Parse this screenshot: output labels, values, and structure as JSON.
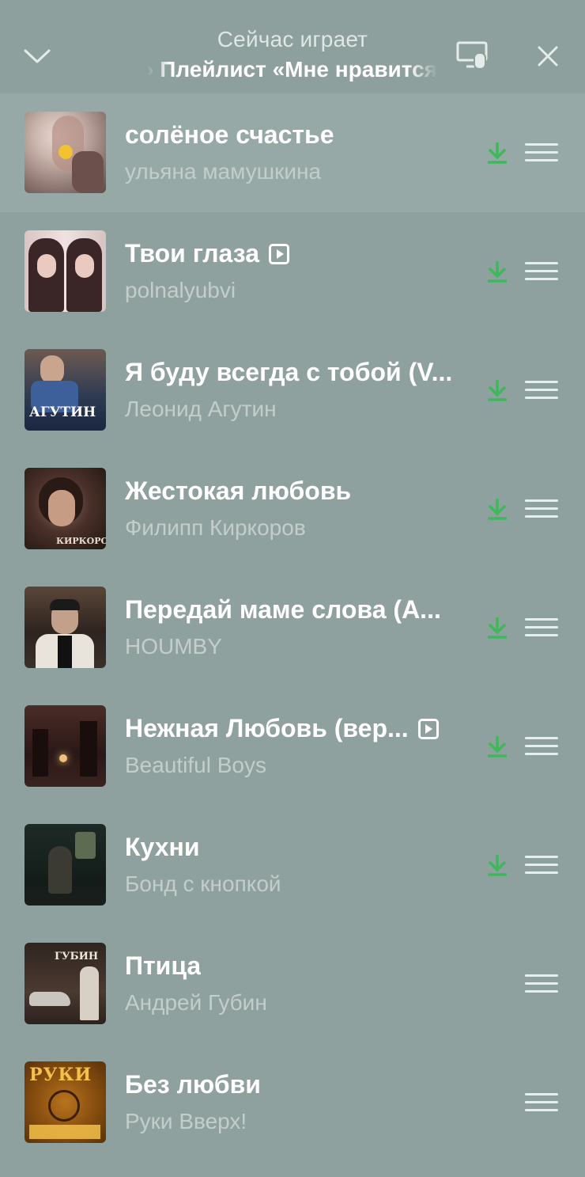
{
  "header": {
    "title": "Сейчас играет",
    "marquee": "Мне нравится»  Плейлист «Мне нравится»  Плейлист «Мне нравится»",
    "collapse_icon": "chevron-down-icon",
    "cast_icon": "cast-device-icon",
    "close_icon": "close-icon"
  },
  "colors": {
    "background": "#8fa19e",
    "current_row": "#97a9a6",
    "download_green": "#3db85a",
    "artist_text": "#c3cecb"
  },
  "tracks": [
    {
      "title": "солёное счастье",
      "artist": "ульяна мамушкина",
      "downloaded": true,
      "video": false,
      "current": true
    },
    {
      "title": "Твои глаза",
      "artist": "polnalyubvi",
      "downloaded": true,
      "video": true,
      "current": false
    },
    {
      "title": "Я буду всегда с тобой (V...",
      "artist": "Леонид Агутин",
      "downloaded": true,
      "video": false,
      "current": false,
      "cover_text": "АГУТИН"
    },
    {
      "title": "Жестокая любовь",
      "artist": "Филипп Киркоров",
      "downloaded": true,
      "video": false,
      "current": false,
      "cover_text": "КИРКОРОВ"
    },
    {
      "title": "Передай маме слова (A...",
      "artist": "HOUMBY",
      "downloaded": true,
      "video": false,
      "current": false
    },
    {
      "title": "Нежная Любовь (вер...",
      "artist": "Beautiful Boys",
      "downloaded": true,
      "video": true,
      "current": false
    },
    {
      "title": "Кухни",
      "artist": "Бонд с кнопкой",
      "downloaded": true,
      "video": false,
      "current": false
    },
    {
      "title": "Птица",
      "artist": "Андрей Губин",
      "downloaded": false,
      "video": false,
      "current": false,
      "cover_text": "ГУБИН"
    },
    {
      "title": "Без любви",
      "artist": "Руки Вверх!",
      "downloaded": false,
      "video": false,
      "current": false,
      "cover_text": "РУКИ"
    }
  ]
}
